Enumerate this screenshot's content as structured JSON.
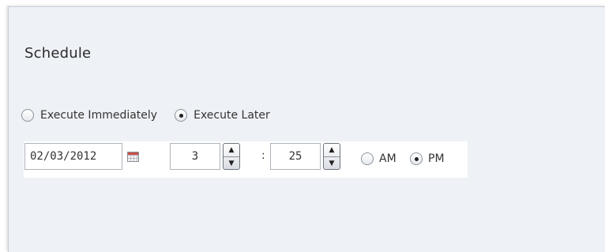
{
  "section": {
    "title": "Schedule"
  },
  "execution": {
    "options": [
      {
        "label": "Execute Immediately",
        "checked": false
      },
      {
        "label": "Execute Later",
        "checked": true
      }
    ]
  },
  "date": {
    "value": "02/03/2012",
    "icon": "calendar-icon"
  },
  "time": {
    "hour": "3",
    "separator": ":",
    "minute": "25",
    "spinner_up": "▲",
    "spinner_down": "▼",
    "meridiem": [
      {
        "label": "AM",
        "checked": false
      },
      {
        "label": "PM",
        "checked": true
      }
    ]
  }
}
